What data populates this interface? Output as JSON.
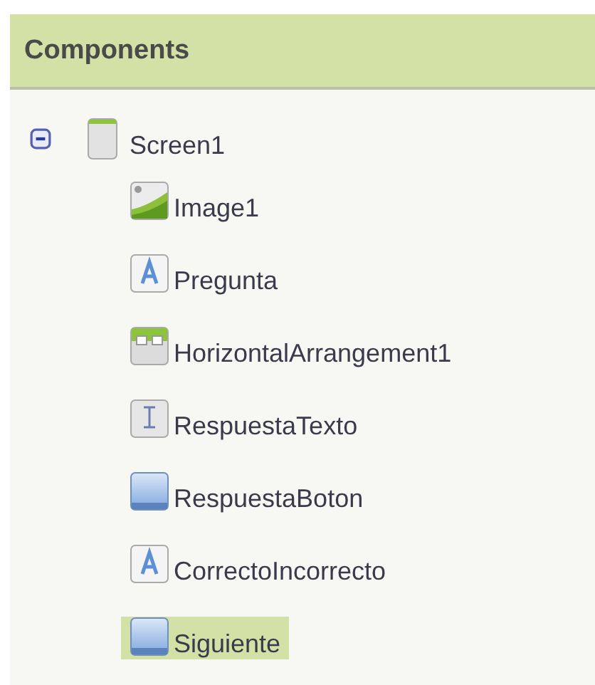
{
  "panel": {
    "title": "Components"
  },
  "tree": [
    {
      "name": "Screen1",
      "kind": "screen",
      "expanded": true,
      "selected": false,
      "children": [
        {
          "name": "Image1",
          "kind": "image",
          "selected": false
        },
        {
          "name": "Pregunta",
          "kind": "label",
          "selected": false
        },
        {
          "name": "HorizontalArrangement1",
          "kind": "arrangement",
          "selected": false
        },
        {
          "name": "RespuestaTexto",
          "kind": "textbox",
          "selected": false
        },
        {
          "name": "RespuestaBoton",
          "kind": "button",
          "selected": false
        },
        {
          "name": "CorrectoIncorrecto",
          "kind": "label",
          "selected": false
        },
        {
          "name": "Siguiente",
          "kind": "button",
          "selected": true
        }
      ]
    }
  ]
}
